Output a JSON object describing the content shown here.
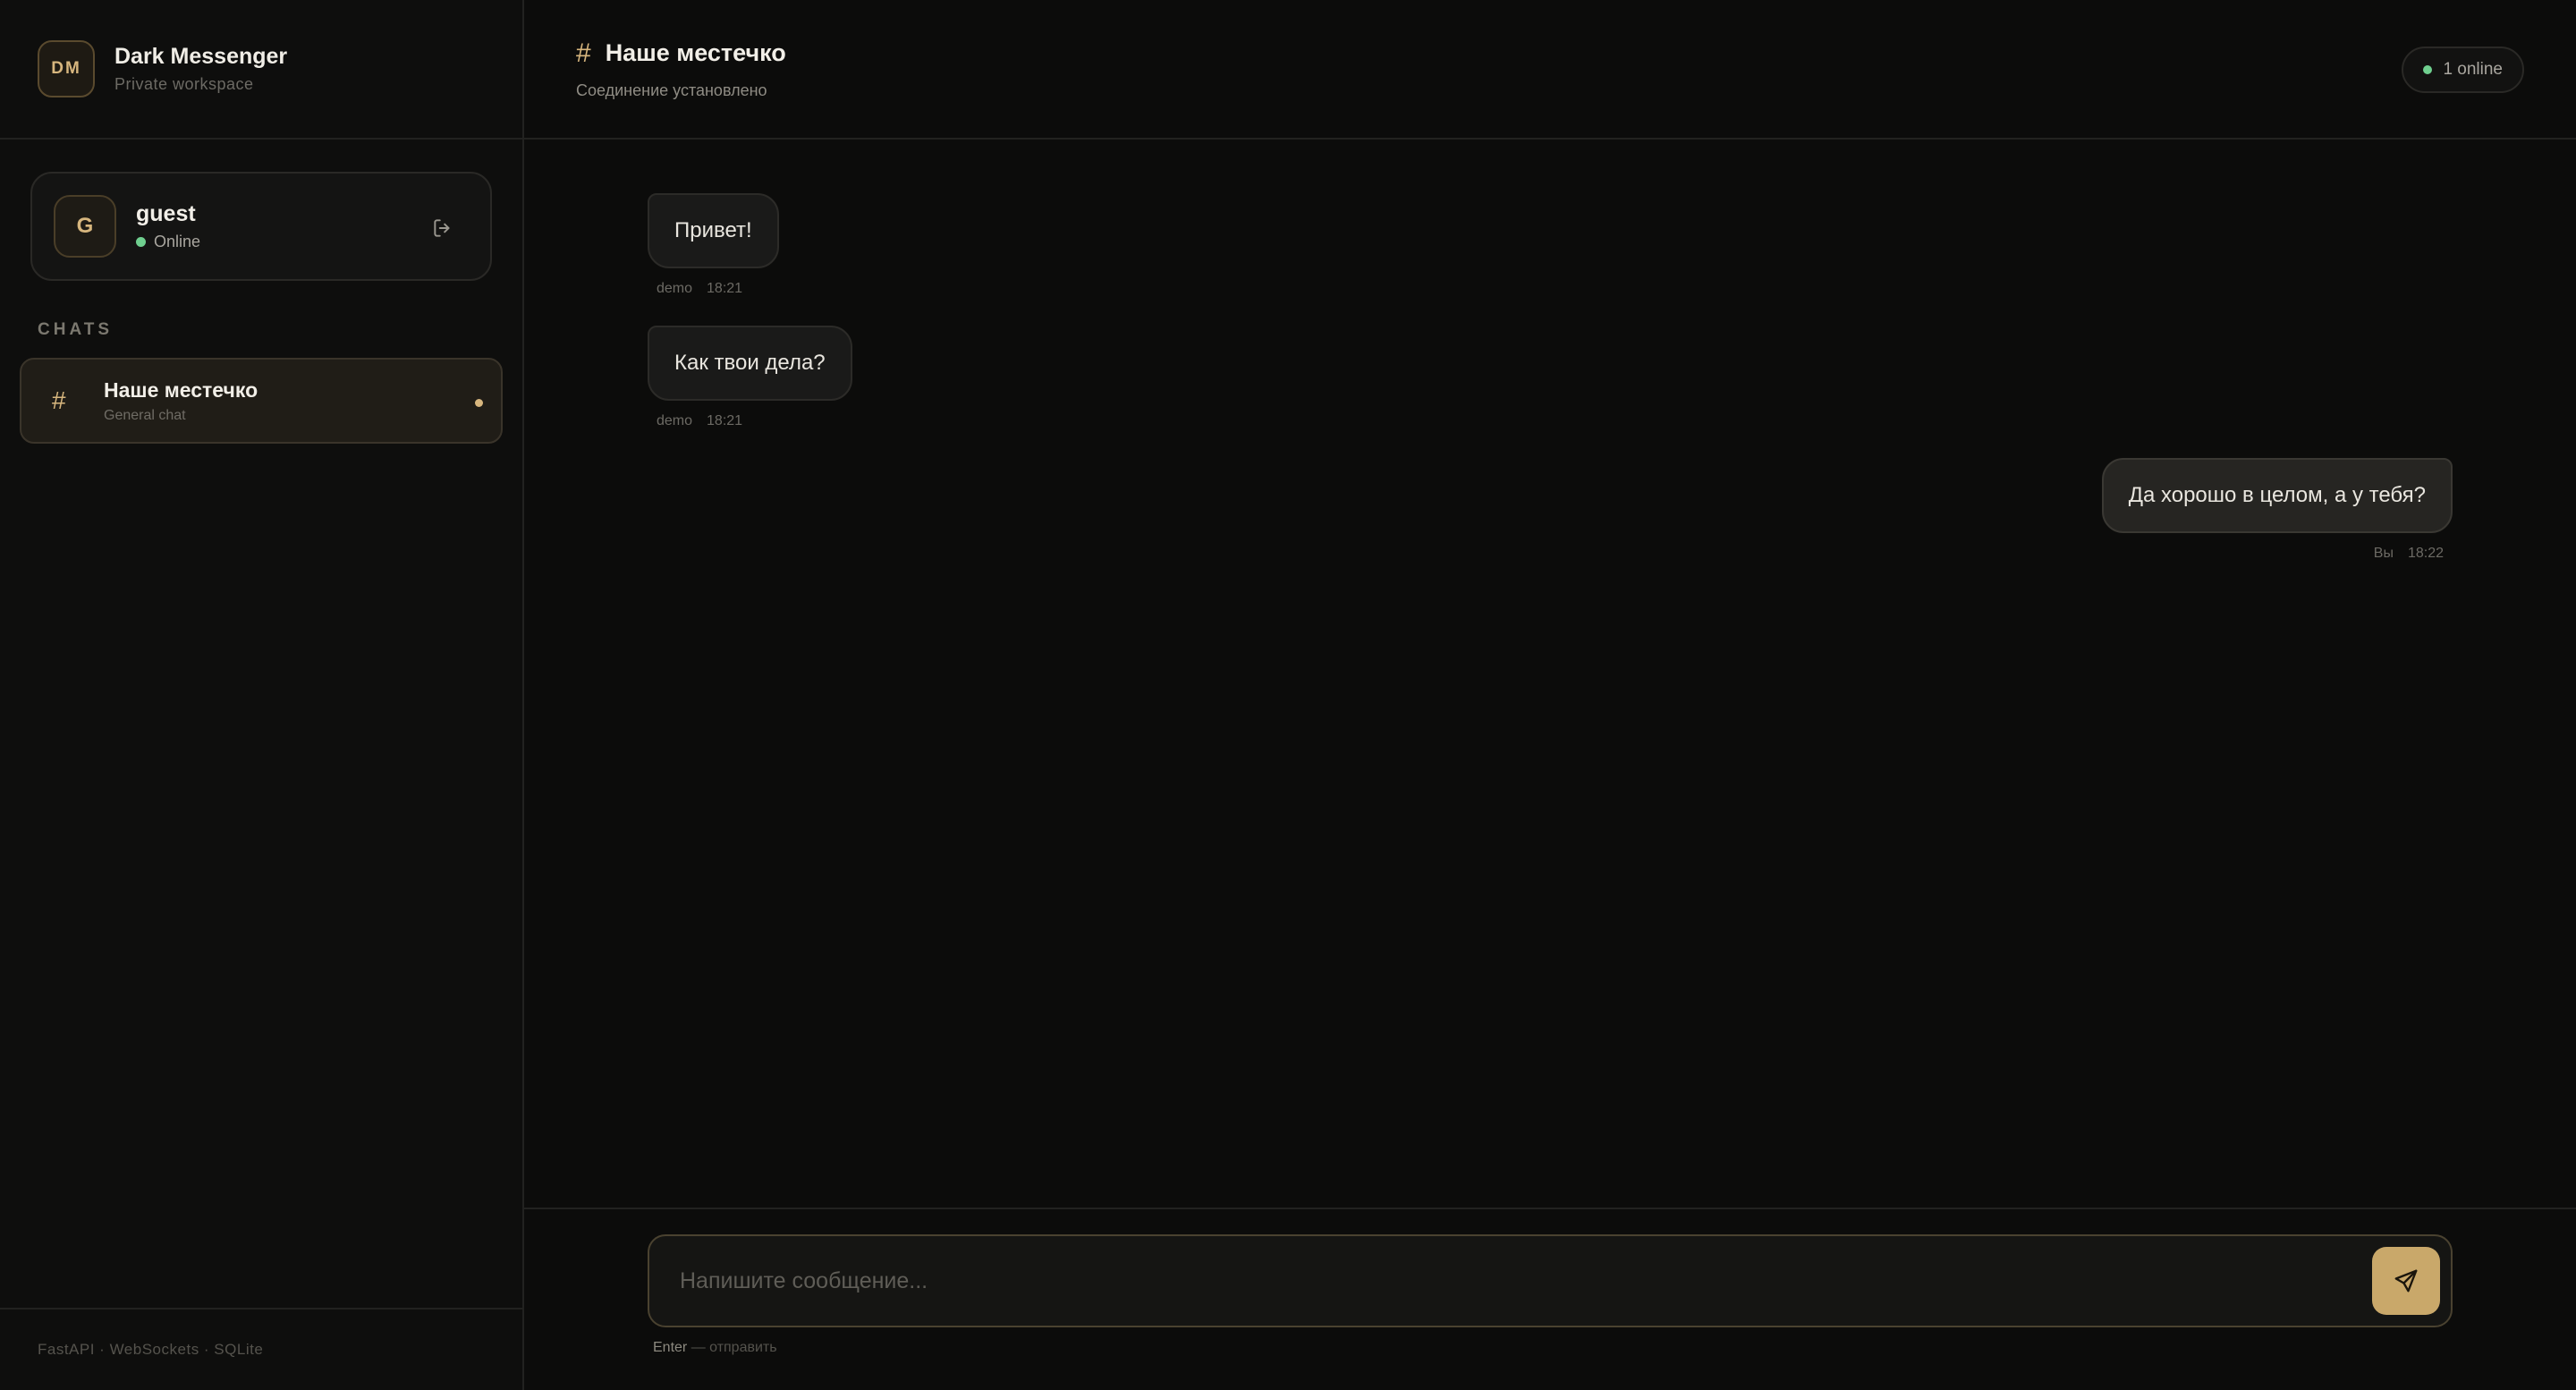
{
  "brand": {
    "logo_text": "DM",
    "title": "Dark Messenger",
    "subtitle": "Private workspace"
  },
  "user": {
    "avatar_initial": "G",
    "name": "guest",
    "status": "Online",
    "logout_icon": "logout-icon"
  },
  "sidebar": {
    "section_label": "CHATS",
    "chats": [
      {
        "icon": "#",
        "name": "Наше местечко",
        "description": "General chat",
        "active": true,
        "unread": true
      }
    ],
    "footer": "FastAPI · WebSockets · SQLite"
  },
  "chat_header": {
    "icon": "#",
    "title": "Наше местечко",
    "subtitle": "Соединение установлено",
    "online": "1 online"
  },
  "messages": [
    {
      "direction": "incoming",
      "text": "Привет!",
      "author": "demo",
      "time": "18:21"
    },
    {
      "direction": "incoming",
      "text": "Как твои дела?",
      "author": "demo",
      "time": "18:21"
    },
    {
      "direction": "outgoing",
      "text": "Да хорошо в целом, а у тебя?",
      "author": "Вы",
      "time": "18:22"
    }
  ],
  "composer": {
    "placeholder": "Напишите сообщение...",
    "value": "",
    "send_icon": "send-icon",
    "hint_key": "Enter",
    "hint_text": " — отправить"
  },
  "colors": {
    "accent": "#d7b67e",
    "send_button": "#c9a86a",
    "online": "#6fcf8f",
    "background": "#0c0c0b"
  }
}
